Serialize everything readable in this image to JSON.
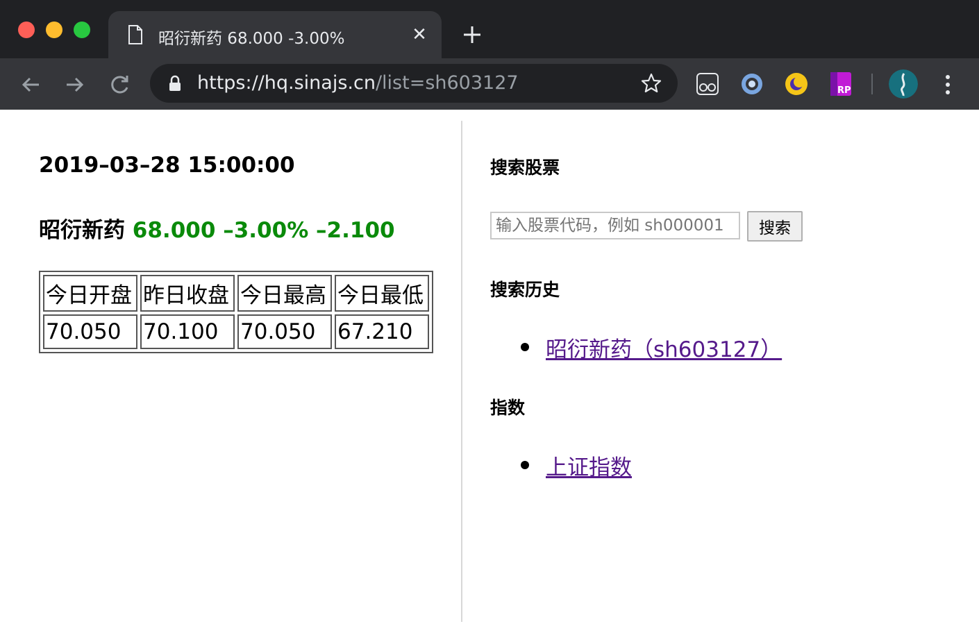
{
  "browser": {
    "tab_title": "昭衍新药 68.000 -3.00%",
    "tab_close": "✕",
    "url_host": "https://hq.sinajs.cn",
    "url_path": "/list=sh603127",
    "extension_badge": "RP"
  },
  "page": {
    "timestamp": "2019–03–28 15:00:00",
    "stock_name": "昭衍新药",
    "price_change": "68.000 –3.00% –2.100",
    "change_color": "#0a8a0a",
    "table": {
      "headers": [
        "今日开盘",
        "昨日收盘",
        "今日最高",
        "今日最低"
      ],
      "values": [
        "70.050",
        "70.100",
        "70.050",
        "67.210"
      ]
    },
    "search": {
      "heading": "搜索股票",
      "placeholder": "输入股票代码，例如 sh000001",
      "button": "搜索"
    },
    "history": {
      "heading": "搜索历史",
      "items": [
        "昭衍新药（sh603127）"
      ]
    },
    "indices": {
      "heading": "指数",
      "items": [
        "上证指数"
      ]
    }
  }
}
